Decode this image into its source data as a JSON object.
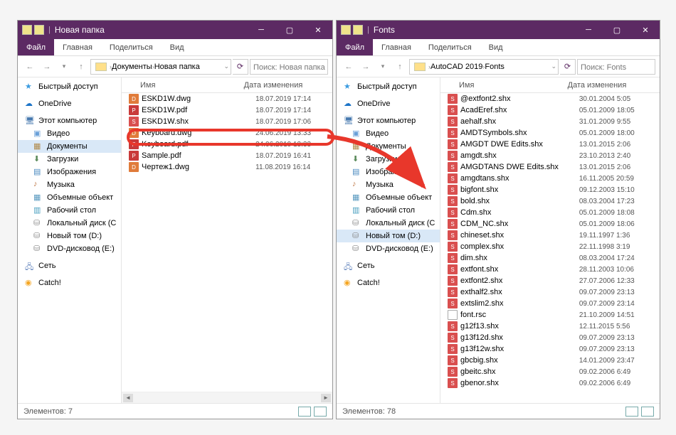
{
  "windows": {
    "left": {
      "title": "Новая папка",
      "tabs": {
        "file": "Файл",
        "home": "Главная",
        "share": "Поделиться",
        "view": "Вид"
      },
      "crumbs": [
        "Документы",
        "Новая папка"
      ],
      "search_placeholder": "Поиск: Новая папка",
      "columns": {
        "name": "Имя",
        "date": "Дата изменения"
      },
      "status": "Элементов: 7"
    },
    "right": {
      "title": "Fonts",
      "tabs": {
        "file": "Файл",
        "home": "Главная",
        "share": "Поделиться",
        "view": "Вид"
      },
      "crumbs": [
        "AutoCAD 2019",
        "Fonts"
      ],
      "search_placeholder": "Поиск: Fonts",
      "columns": {
        "name": "Имя",
        "date": "Дата изменения"
      },
      "status": "Элементов: 78"
    }
  },
  "sidebar": {
    "quick": "Быстрый доступ",
    "onedrive": "OneDrive",
    "thispc": "Этот компьютер",
    "videos": "Видео",
    "documents": "Документы",
    "downloads": "Загрузки",
    "pictures": "Изображения",
    "music": "Музыка",
    "objects3d": "Объемные объект",
    "desktop": "Рабочий стол",
    "disk_c": "Локальный диск (C",
    "disk_d": "Новый том (D:)",
    "dvd": "DVD-дисковод (E:)",
    "network": "Сеть",
    "catch": "Catch!"
  },
  "files_left": [
    {
      "icon": "dwg",
      "name": "ESKD1W.dwg",
      "date": "18.07.2019 17:14"
    },
    {
      "icon": "pdf",
      "name": "ESKD1W.pdf",
      "date": "18.07.2019 17:14"
    },
    {
      "icon": "shx",
      "name": "ESKD1W.shx",
      "date": "18.07.2019 17:06"
    },
    {
      "icon": "dwg",
      "name": "Keyboard.dwg",
      "date": "24.06.2019 13:33"
    },
    {
      "icon": "pdf",
      "name": "Keyboard.pdf",
      "date": "24.06.2019 13:33"
    },
    {
      "icon": "pdf",
      "name": "Sample.pdf",
      "date": "18.07.2019 16:41"
    },
    {
      "icon": "dwg",
      "name": "Чертеж1.dwg",
      "date": "11.08.2019 16:14"
    }
  ],
  "files_right": [
    {
      "icon": "shx",
      "name": "@extfont2.shx",
      "date": "30.01.2004 5:05"
    },
    {
      "icon": "shx",
      "name": "AcadEref.shx",
      "date": "05.01.2009 18:05"
    },
    {
      "icon": "shx",
      "name": "aehalf.shx",
      "date": "31.01.2009 9:55"
    },
    {
      "icon": "shx",
      "name": "AMDTSymbols.shx",
      "date": "05.01.2009 18:00"
    },
    {
      "icon": "shx",
      "name": "AMGDT DWE Edits.shx",
      "date": "13.01.2015 2:06"
    },
    {
      "icon": "shx",
      "name": "amgdt.shx",
      "date": "23.10.2013 2:40"
    },
    {
      "icon": "shx",
      "name": "AMGDTANS DWE Edits.shx",
      "date": "13.01.2015 2:06"
    },
    {
      "icon": "shx",
      "name": "amgdtans.shx",
      "date": "16.11.2005 20:59"
    },
    {
      "icon": "shx",
      "name": "bigfont.shx",
      "date": "09.12.2003 15:10"
    },
    {
      "icon": "shx",
      "name": "bold.shx",
      "date": "08.03.2004 17:23"
    },
    {
      "icon": "shx",
      "name": "Cdm.shx",
      "date": "05.01.2009 18:08"
    },
    {
      "icon": "shx",
      "name": "CDM_NC.shx",
      "date": "05.01.2009 18:06"
    },
    {
      "icon": "shx",
      "name": "chineset.shx",
      "date": "19.11.1997 1:36"
    },
    {
      "icon": "shx",
      "name": "complex.shx",
      "date": "22.11.1998 3:19"
    },
    {
      "icon": "shx",
      "name": "dim.shx",
      "date": "08.03.2004 17:24"
    },
    {
      "icon": "shx",
      "name": "extfont.shx",
      "date": "28.11.2003 10:06"
    },
    {
      "icon": "shx",
      "name": "extfont2.shx",
      "date": "27.07.2006 12:33"
    },
    {
      "icon": "shx",
      "name": "exthalf2.shx",
      "date": "09.07.2009 23:13"
    },
    {
      "icon": "shx",
      "name": "extslim2.shx",
      "date": "09.07.2009 23:14"
    },
    {
      "icon": "rsc",
      "name": "font.rsc",
      "date": "21.10.2009 14:51"
    },
    {
      "icon": "shx",
      "name": "g12f13.shx",
      "date": "12.11.2015 5:56"
    },
    {
      "icon": "shx",
      "name": "g13f12d.shx",
      "date": "09.07.2009 23:13"
    },
    {
      "icon": "shx",
      "name": "g13f12w.shx",
      "date": "09.07.2009 23:13"
    },
    {
      "icon": "shx",
      "name": "gbcbig.shx",
      "date": "14.01.2009 23:47"
    },
    {
      "icon": "shx",
      "name": "gbeitc.shx",
      "date": "09.02.2006 6:49"
    },
    {
      "icon": "shx",
      "name": "gbenor.shx",
      "date": "09.02.2006 6:49"
    }
  ]
}
